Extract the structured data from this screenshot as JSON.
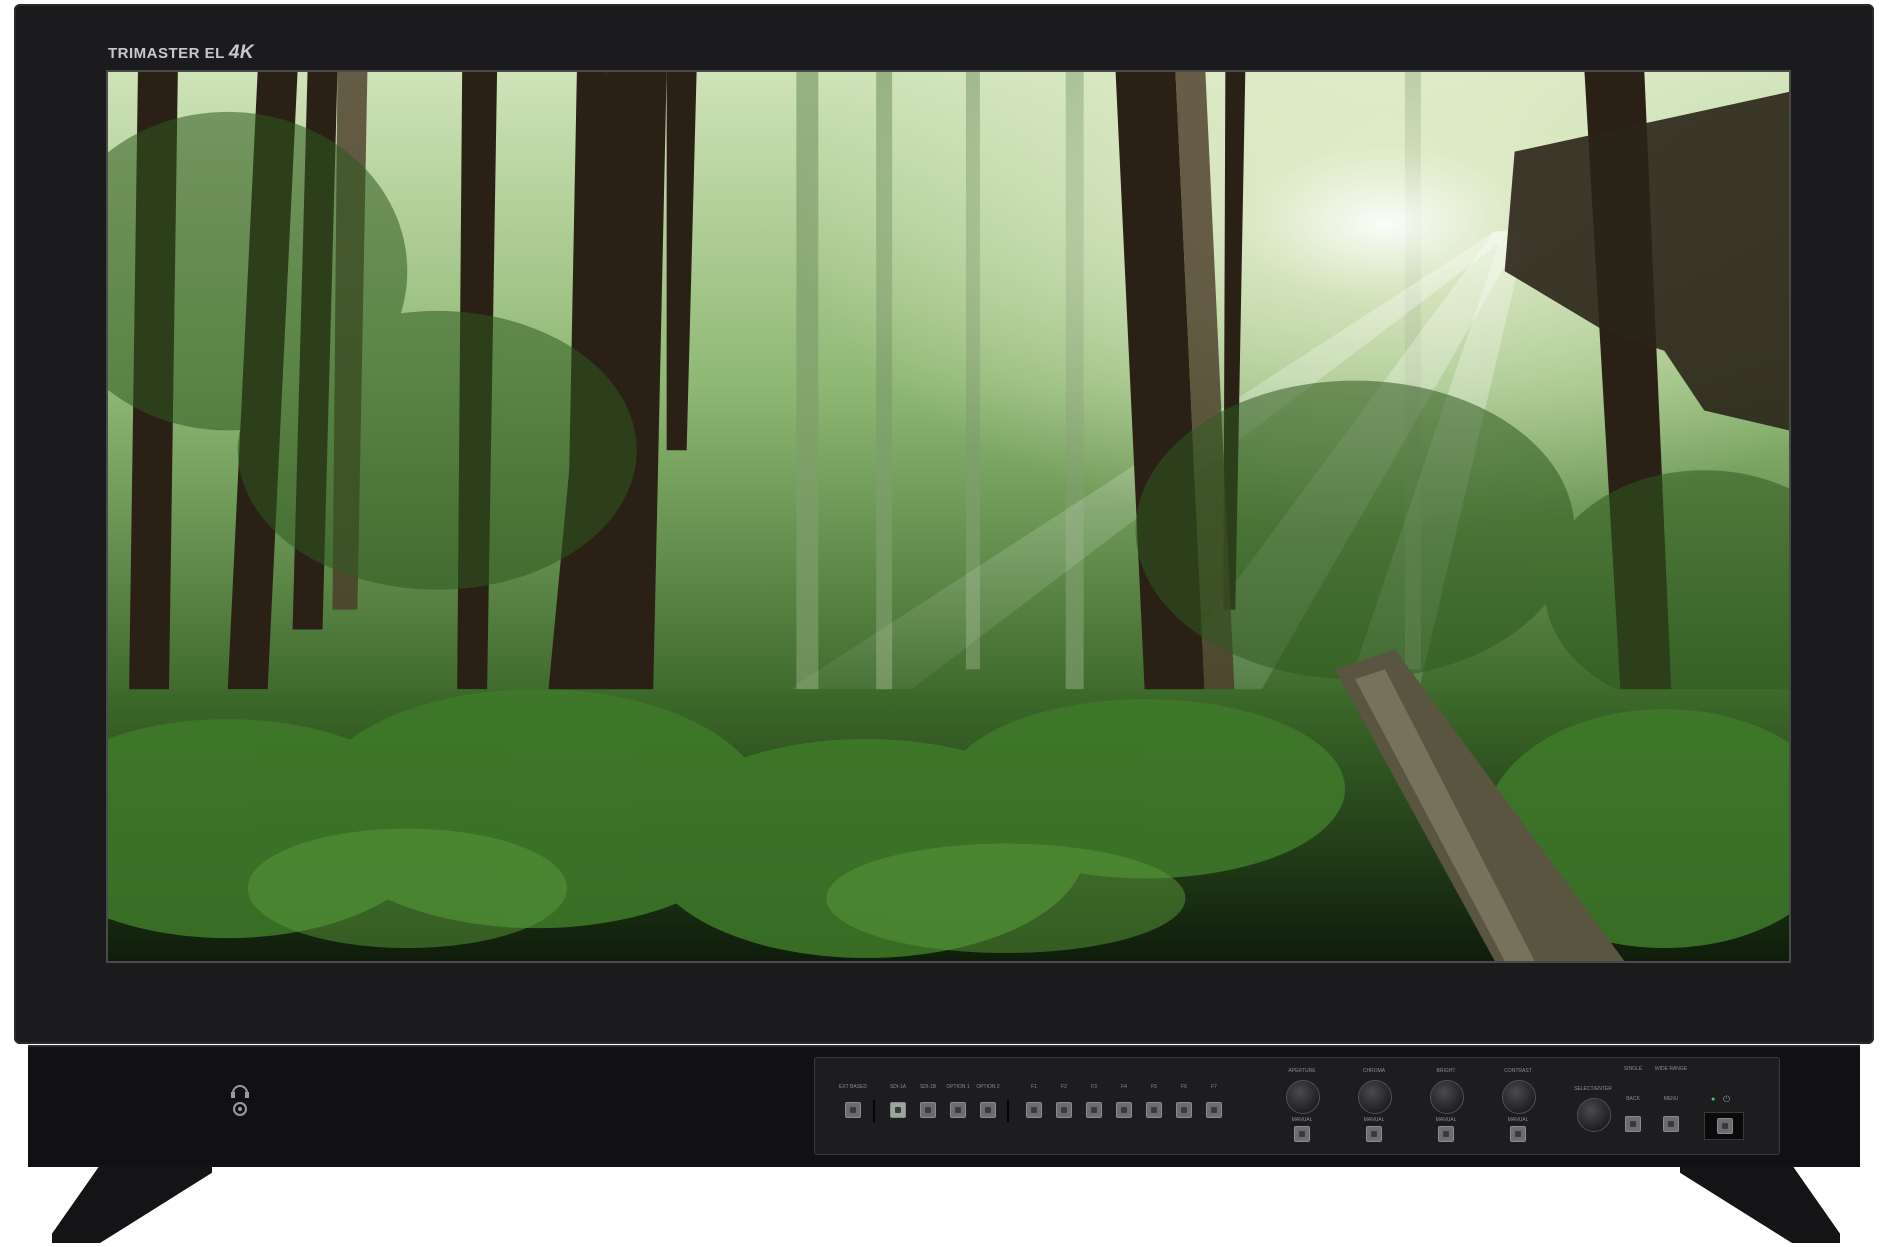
{
  "brand": {
    "name": "TRIMASTER EL",
    "model": "4K"
  },
  "screen_image": "redwood-forest-with-sunbeams",
  "controls": {
    "input_group": [
      {
        "label": "EXT BASED",
        "name": "ext-based-button"
      },
      {
        "label": "SDI-1A",
        "name": "sdi-1a-button"
      },
      {
        "label": "SDI-1B",
        "name": "sdi-1b-button"
      },
      {
        "label": "OPTION 1",
        "name": "option-1-button"
      },
      {
        "label": "OPTION 2",
        "name": "option-2-button"
      }
    ],
    "function_keys": [
      "F1",
      "F2",
      "F3",
      "F4",
      "F5",
      "F6",
      "F7"
    ],
    "knobs": [
      {
        "label": "APERTURE",
        "sub": "MANUAL"
      },
      {
        "label": "CHROMA",
        "sub": "MANUAL"
      },
      {
        "label": "BRIGHT",
        "sub": "MANUAL"
      },
      {
        "label": "CONTRAST",
        "sub": "MANUAL"
      }
    ],
    "select_knob": "SELECT/ENTER",
    "small_labels": [
      "SINGLE",
      "WIDE RANGE"
    ],
    "back": "BACK",
    "menu": "MENU",
    "power": "power-button"
  },
  "colors": {
    "bezel": "#1b1b1d",
    "button": "#6b6b70",
    "label": "#8d8d92"
  }
}
